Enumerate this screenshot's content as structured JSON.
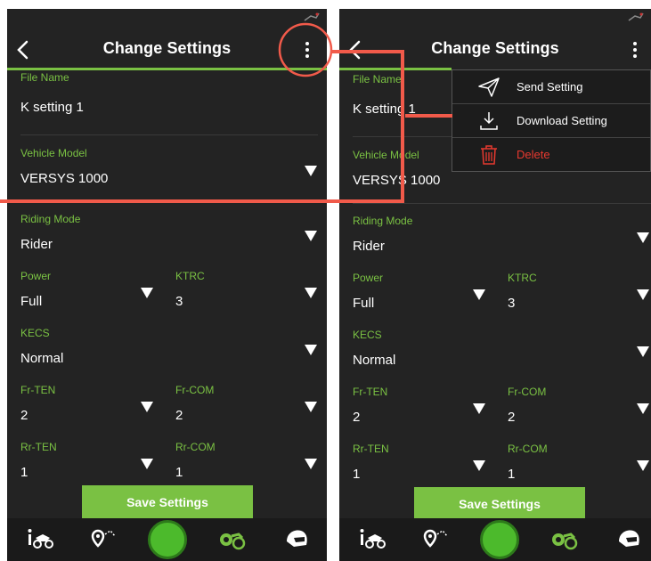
{
  "screen": {
    "title": "Change Settings",
    "fields": {
      "file_name": {
        "label": "File Name",
        "value": "K setting 1"
      },
      "vehicle_model": {
        "label": "Vehicle Model",
        "value": "VERSYS 1000"
      },
      "riding_mode": {
        "label": "Riding Mode",
        "value": "Rider"
      },
      "power": {
        "label": "Power",
        "value": "Full"
      },
      "ktrc": {
        "label": "KTRC",
        "value": "3"
      },
      "kecs": {
        "label": "KECS",
        "value": "Normal"
      },
      "fr_ten": {
        "label": "Fr-TEN",
        "value": "2"
      },
      "fr_com": {
        "label": "Fr-COM",
        "value": "2"
      },
      "rr_ten": {
        "label": "Rr-TEN",
        "value": "1"
      },
      "rr_com": {
        "label": "Rr-COM",
        "value": "1"
      }
    },
    "save_label": "Save Settings"
  },
  "menu": {
    "items": [
      {
        "label": "Send Setting",
        "icon": "paper-plane-icon"
      },
      {
        "label": "Download Setting",
        "icon": "download-icon"
      },
      {
        "label": "Delete",
        "icon": "trash-icon"
      }
    ]
  },
  "bottom_nav": {
    "items": [
      "bike-info-icon",
      "map-route-icon",
      "home-button",
      "bike-settings-icon",
      "helmet-icon"
    ]
  },
  "colors": {
    "accent": "#7ac143",
    "background": "#232323",
    "annotation": "#f15a4a",
    "delete": "#e8392f"
  }
}
